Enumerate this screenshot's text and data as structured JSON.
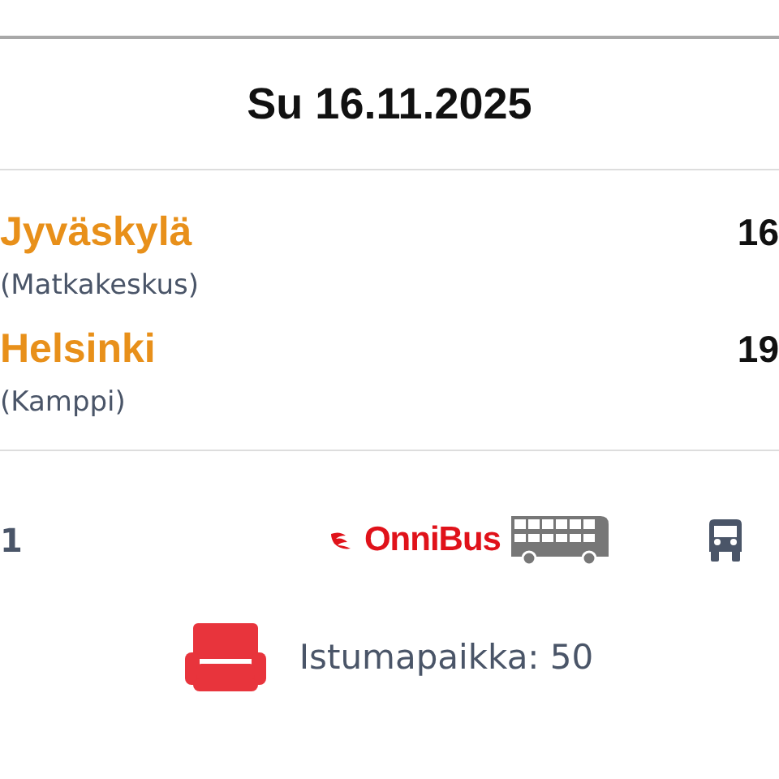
{
  "date": "Su 16.11.2025",
  "stops": [
    {
      "city": "Jyväskylä",
      "place": "(Matkakeskus)",
      "time": "16"
    },
    {
      "city": "Helsinki",
      "place": "(Kamppi)",
      "time": "19"
    }
  ],
  "operator": {
    "left_text": "1",
    "brand": "OnniBus"
  },
  "seats": {
    "label": "Istumapaikka: 50"
  }
}
